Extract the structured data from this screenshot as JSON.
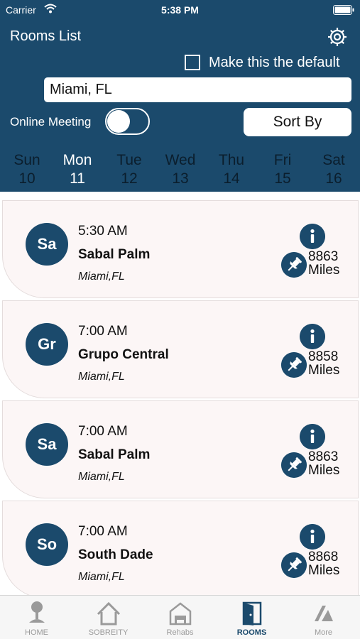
{
  "status_bar": {
    "carrier": "Carrier",
    "time": "5:38 PM"
  },
  "header": {
    "title": "Rooms List",
    "default_label": "Make this the default",
    "default_checked": false,
    "location_value": "Miami, FL",
    "online_label": "Online Meeting",
    "online_on": false,
    "sort_label": "Sort By",
    "bg_color": "#1b4a6c"
  },
  "days": [
    {
      "name": "Sun",
      "date": "10"
    },
    {
      "name": "Mon",
      "date": "11",
      "selected": true
    },
    {
      "name": "Tue",
      "date": "12"
    },
    {
      "name": "Wed",
      "date": "13"
    },
    {
      "name": "Thu",
      "date": "14"
    },
    {
      "name": "Fri",
      "date": "15"
    },
    {
      "name": "Sat",
      "date": "16"
    }
  ],
  "rooms": [
    {
      "initials": "Sa",
      "time": "5:30 AM",
      "name": "Sabal Palm",
      "city": "Miami,FL",
      "distance": "8863",
      "unit": "Miles"
    },
    {
      "initials": "Gr",
      "time": "7:00 AM",
      "name": "Grupo Central",
      "city": "Miami,FL",
      "distance": "8858",
      "unit": "Miles"
    },
    {
      "initials": "Sa",
      "time": "7:00 AM",
      "name": "Sabal Palm",
      "city": "Miami,FL",
      "distance": "8863",
      "unit": "Miles"
    },
    {
      "initials": "So",
      "time": "7:00 AM",
      "name": "South Dade",
      "city": "Miami,FL",
      "distance": "8868",
      "unit": "Miles"
    }
  ],
  "tabs": [
    {
      "label": "HOME",
      "icon": "home-icon"
    },
    {
      "label": "SOBREITY",
      "icon": "sobreity-icon"
    },
    {
      "label": "Rehabs",
      "icon": "rehabs-icon"
    },
    {
      "label": "ROOMS",
      "icon": "rooms-icon",
      "active": true
    },
    {
      "label": "More",
      "icon": "more-icon"
    }
  ]
}
